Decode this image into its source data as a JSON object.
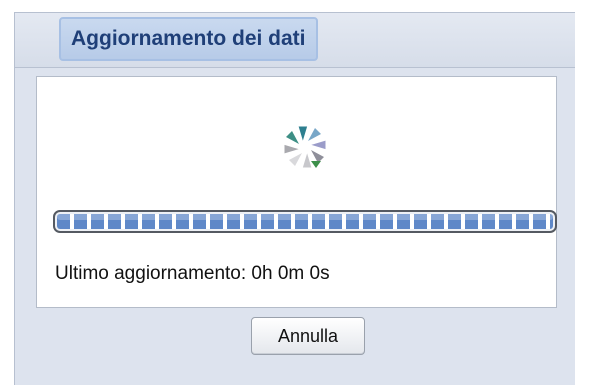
{
  "dialog": {
    "title": "Aggiornamento dei dati",
    "status_text": "Ultimo aggiornamento: 0h 0m 0s",
    "cancel_label": "Annulla",
    "progress_fraction": 1.0,
    "icons": {
      "spinner": "loading-spinner-icon"
    },
    "colors": {
      "title_text": "#1f3f78",
      "progress_blocks": "#5f88c8",
      "background": "#dde3ee"
    }
  }
}
